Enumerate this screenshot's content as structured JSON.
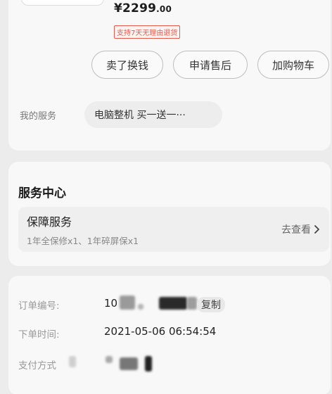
{
  "product": {
    "price_int": "¥2299",
    "price_dec": ".00",
    "return_badge": "支持7天无理由退货"
  },
  "actions": [
    {
      "label": "卖了换钱"
    },
    {
      "label": "申请售后"
    },
    {
      "label": "加购物车"
    }
  ],
  "my_service": {
    "label": "我的服务",
    "chip": "电脑整机 买一送一···"
  },
  "service_center": {
    "title": "服务中心",
    "guarantee_title": "保障服务",
    "guarantee_desc": "1年全保修x1、1年碎屏保x1",
    "link": "去查看"
  },
  "order": {
    "number_label": "订单编号:",
    "number_value": "10",
    "copy_label": "复制",
    "time_label": "下单时间:",
    "time_value": "2021-05-06 06:54:54",
    "pay_label": "支付方式"
  },
  "colors": {
    "accent_red": "#e8594a",
    "background": "#ececec",
    "card": "#f8f8f8"
  },
  "icons": {
    "link_arrow": "chevron-right-icon"
  }
}
